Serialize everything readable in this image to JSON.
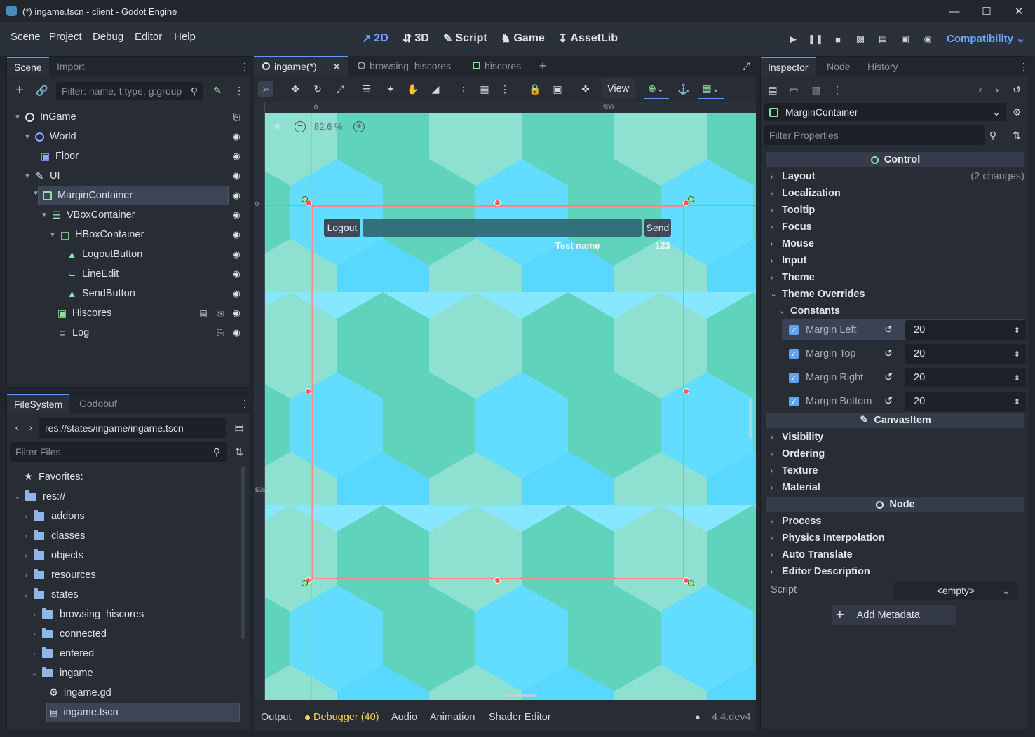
{
  "window": {
    "title": "(*) ingame.tscn - client - Godot Engine"
  },
  "menu": [
    "Scene",
    "Project",
    "Debug",
    "Editor",
    "Help"
  ],
  "modes": [
    {
      "label": "2D",
      "icon": "2d-icon",
      "active": true
    },
    {
      "label": "3D",
      "icon": "3d-icon",
      "active": false
    },
    {
      "label": "Script",
      "icon": "script-icon",
      "active": false
    },
    {
      "label": "Game",
      "icon": "game-icon",
      "active": false
    },
    {
      "label": "AssetLib",
      "icon": "assetlib-icon",
      "active": false
    }
  ],
  "renderer": "Compatibility",
  "scene_dock": {
    "tabs": [
      "Scene",
      "Import"
    ],
    "filter_placeholder": "Filter: name, t:type, g:group",
    "nodes": [
      {
        "label": "InGame",
        "icon": "node-icon"
      },
      {
        "label": "World",
        "icon": "node2d-icon"
      },
      {
        "label": "Floor",
        "icon": "tilemap-icon"
      },
      {
        "label": "UI",
        "icon": "canvaslayer-icon"
      },
      {
        "label": "MarginContainer",
        "icon": "margincontainer-icon"
      },
      {
        "label": "VBoxContainer",
        "icon": "vboxcontainer-icon"
      },
      {
        "label": "HBoxContainer",
        "icon": "hboxcontainer-icon"
      },
      {
        "label": "LogoutButton",
        "icon": "button-icon"
      },
      {
        "label": "LineEdit",
        "icon": "lineedit-icon"
      },
      {
        "label": "SendButton",
        "icon": "button-icon"
      },
      {
        "label": "Hiscores",
        "icon": "instance-icon"
      },
      {
        "label": "Log",
        "icon": "richtextlabel-icon"
      }
    ]
  },
  "filesystem": {
    "tabs": [
      "FileSystem",
      "Godobuf"
    ],
    "path": "res://states/ingame/ingame.tscn",
    "filter_placeholder": "Filter Files",
    "items": [
      {
        "label": "Favorites:"
      },
      {
        "label": "res://"
      },
      {
        "label": "addons"
      },
      {
        "label": "classes"
      },
      {
        "label": "objects"
      },
      {
        "label": "resources"
      },
      {
        "label": "states"
      },
      {
        "label": "browsing_hiscores"
      },
      {
        "label": "connected"
      },
      {
        "label": "entered"
      },
      {
        "label": "ingame"
      },
      {
        "label": "ingame.gd"
      },
      {
        "label": "ingame.tscn"
      }
    ]
  },
  "editor_tabs": [
    "ingame(*)",
    "browsing_hiscores",
    "hiscores"
  ],
  "toolbar": {
    "view": "View"
  },
  "viewport": {
    "zoom": "82.6 %",
    "ruler_top": [
      "0",
      "500"
    ],
    "ruler_left": [
      "0",
      "500"
    ],
    "logout": "Logout",
    "send": "Send",
    "test_name": "Test name",
    "score": "123"
  },
  "bottom_tabs": [
    "Output",
    "Debugger (40)",
    "Audio",
    "Animation",
    "Shader Editor"
  ],
  "version": "4.4.dev4",
  "inspector": {
    "tabs": [
      "Inspector",
      "Node",
      "History"
    ],
    "node_name": "MarginContainer",
    "filter_placeholder": "Filter Properties",
    "section_control": "Control",
    "layout": "Layout",
    "layout_changes": "(2 changes)",
    "control_groups": [
      "Localization",
      "Tooltip",
      "Focus",
      "Mouse",
      "Input",
      "Theme",
      "Theme Overrides"
    ],
    "constants": "Constants",
    "constant_rows": [
      {
        "label": "Margin Left",
        "value": "20"
      },
      {
        "label": "Margin Top",
        "value": "20"
      },
      {
        "label": "Margin Right",
        "value": "20"
      },
      {
        "label": "Margin Bottom",
        "value": "20"
      }
    ],
    "section_canvas": "CanvasItem",
    "canvas_groups": [
      "Visibility",
      "Ordering",
      "Texture",
      "Material"
    ],
    "section_node": "Node",
    "node_groups": [
      "Process",
      "Physics Interpolation",
      "Auto Translate",
      "Editor Description"
    ],
    "script_label": "Script",
    "script_value": "<empty>",
    "add_metadata": "Add Metadata"
  },
  "colors": {
    "accent": "#5a9bff",
    "green": "#8fe0a3",
    "hex_light": "#86e7ff",
    "hex_teal": "#5fd3bb"
  }
}
